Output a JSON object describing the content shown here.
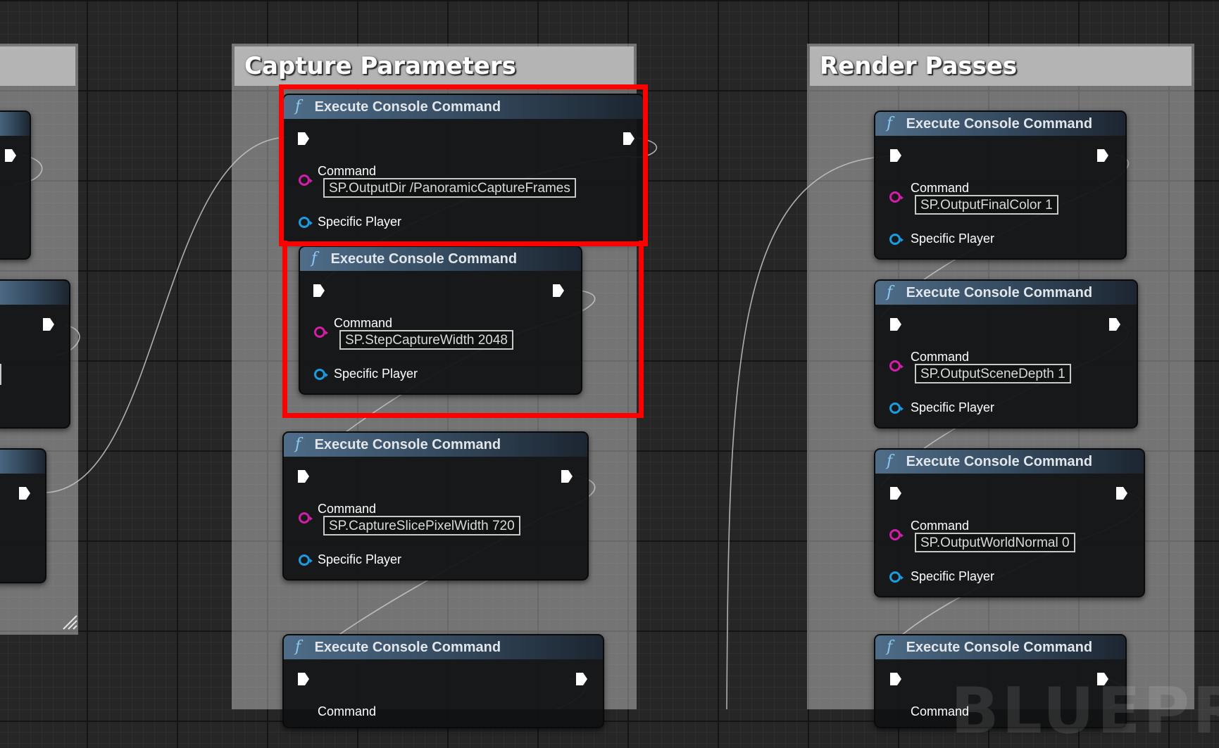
{
  "comments": {
    "left_label": "",
    "capture_title": "Capture Parameters",
    "render_title": "Render Passes"
  },
  "node_common": {
    "title": "Execute Console Command",
    "func_icon": "f",
    "command_label": "Command",
    "player_label": "Specific Player"
  },
  "capture_nodes": [
    {
      "command": "SP.OutputDir /PanoramicCaptureFrames",
      "highlighted": true
    },
    {
      "command": "SP.StepCaptureWidth 2048",
      "highlighted": true
    },
    {
      "command": "SP.CaptureSlicePixelWidth 720",
      "highlighted": false
    },
    {
      "command": "",
      "highlighted": false
    }
  ],
  "render_nodes": [
    {
      "command": "SP.OutputFinalColor 1"
    },
    {
      "command": "SP.OutputSceneDepth 1"
    },
    {
      "command": "SP.OutputWorldNormal 0"
    },
    {
      "command": ""
    }
  ],
  "watermark": "BLUEPRIN",
  "colors": {
    "highlight": "#ff0000",
    "string_pin": "#d21ea8",
    "object_pin": "#1b9be0",
    "exec_pin": "#ffffff",
    "node_header": "#4f6d89"
  },
  "icons": [
    "function-icon",
    "exec-pin-icon",
    "string-pin-icon",
    "object-pin-icon",
    "resize-handle-icon"
  ]
}
